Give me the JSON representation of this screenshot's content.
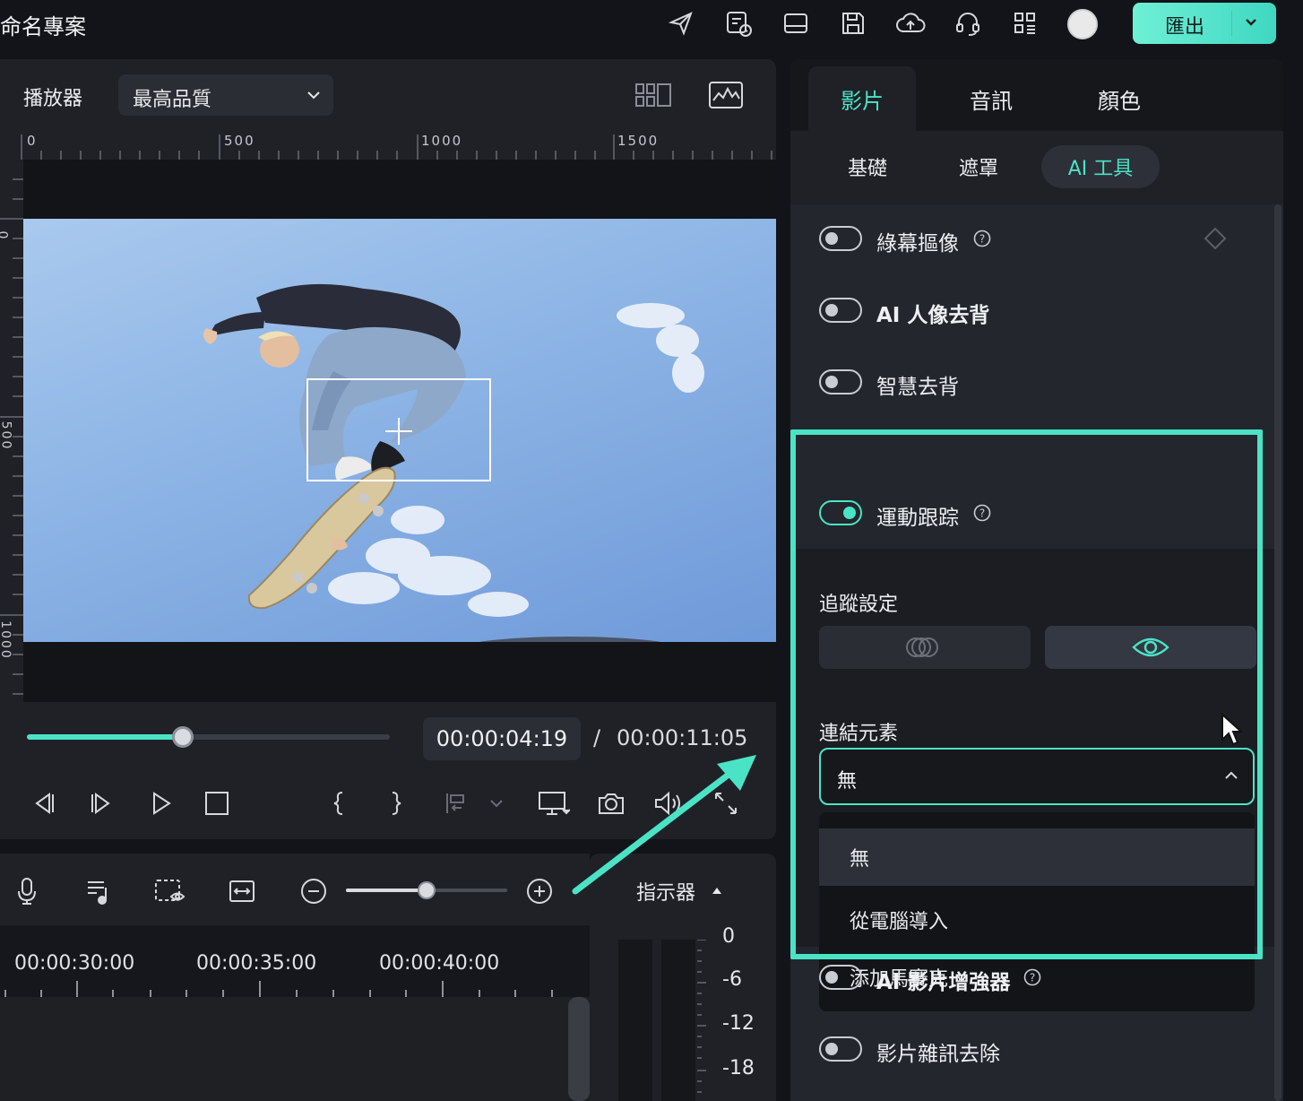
{
  "app": {
    "project_title": "命名專案",
    "export_label": "匯出",
    "accent_color": "#4be3c6",
    "top_icons": [
      "send-icon",
      "task-list-icon",
      "layout-icon",
      "save-icon",
      "cloud-upload-icon",
      "headset-icon",
      "apps-grid-icon",
      "avatar"
    ]
  },
  "player": {
    "label": "播放器",
    "quality": "最高品質",
    "ruler_h": [
      "0",
      "500",
      "1000",
      "1500"
    ],
    "ruler_v": [
      "0",
      "500",
      "1000"
    ],
    "current_time": "00:00:04:19",
    "time_separator": "/",
    "total_time": "00:00:11:05",
    "progress": 0.43,
    "controls": [
      "prev-frame-icon",
      "next-frame-icon",
      "play-icon",
      "stop-icon",
      "mark-in-icon",
      "mark-out-icon",
      "insert-icon",
      "display-icon",
      "snapshot-icon",
      "volume-icon",
      "fullscreen-icon"
    ]
  },
  "timeline": {
    "tools": [
      "microphone-icon",
      "music-list-icon",
      "preview-icon",
      "fit-icon",
      "zoom-out-icon",
      "zoom-in-icon"
    ],
    "zoom_level": 0.5,
    "times": [
      "00:00:30:00",
      "00:00:35:00",
      "00:00:40:00"
    ]
  },
  "meter": {
    "label": "指示器",
    "scale": [
      "0",
      "-6",
      "-12",
      "-18"
    ]
  },
  "properties": {
    "main_tabs": [
      {
        "label": "影片",
        "active": true
      },
      {
        "label": "音訊",
        "active": false
      },
      {
        "label": "顏色",
        "active": false
      }
    ],
    "sub_tabs": [
      {
        "label": "基礎",
        "active": false
      },
      {
        "label": "遮罩",
        "active": false
      },
      {
        "label": "AI 工具",
        "active": true
      }
    ],
    "rows": [
      {
        "label": "綠幕摳像",
        "on": false,
        "help": true
      },
      {
        "label": "AI 人像去背",
        "on": false,
        "help": false
      },
      {
        "label": "智慧去背",
        "on": false,
        "help": false
      },
      {
        "label": "運動跟踪",
        "on": true,
        "help": true
      },
      {
        "label": "AI 影片增強器",
        "on": false,
        "help": true
      },
      {
        "label": "影片雜訊去除",
        "on": false,
        "help": false
      }
    ],
    "tracking": {
      "settings_label": "追蹤設定",
      "link_label": "連結元素",
      "link_value": "無",
      "options": [
        "無",
        "從電腦導入",
        "添加馬賽克"
      ]
    }
  }
}
